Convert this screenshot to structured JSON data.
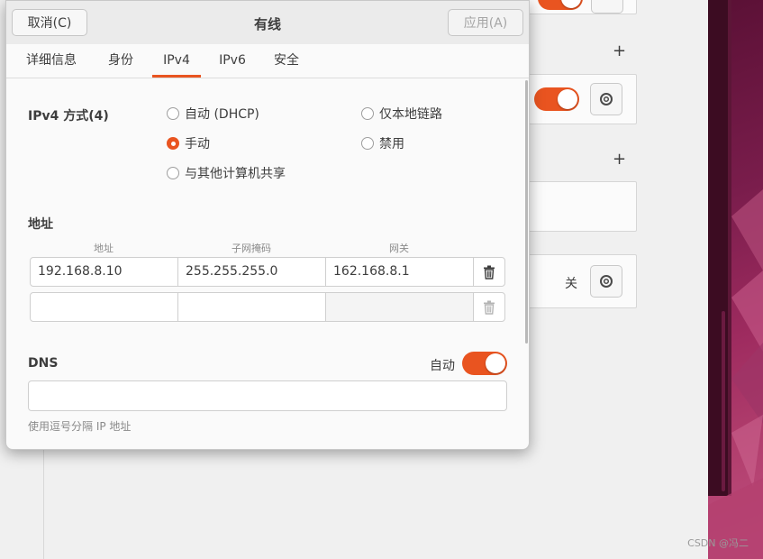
{
  "dialog": {
    "title": "有线",
    "cancel_label": "取消(C)",
    "apply_label": "应用(A)"
  },
  "tabs": [
    {
      "label": "详细信息",
      "active": false
    },
    {
      "label": "身份",
      "active": false
    },
    {
      "label": "IPv4",
      "active": true
    },
    {
      "label": "IPv6",
      "active": false
    },
    {
      "label": "安全",
      "active": false
    }
  ],
  "ipv4_method": {
    "label": "IPv4 方式(4)",
    "options": [
      {
        "label": "自动 (DHCP)",
        "selected": false
      },
      {
        "label": "仅本地链路",
        "selected": false
      },
      {
        "label": "手动",
        "selected": true
      },
      {
        "label": "禁用",
        "selected": false
      },
      {
        "label": "与其他计算机共享",
        "selected": false
      }
    ]
  },
  "addresses": {
    "label": "地址",
    "columns": [
      "地址",
      "子网掩码",
      "网关"
    ],
    "rows": [
      {
        "address": "192.168.8.10",
        "netmask": "255.255.255.0",
        "gateway": "162.168.8.1"
      },
      {
        "address": "",
        "netmask": "",
        "gateway": ""
      }
    ]
  },
  "dns": {
    "label": "DNS",
    "auto_label": "自动",
    "auto_enabled": true,
    "value": "",
    "hint": "使用逗号分隔 IP 地址"
  },
  "background": {
    "off_label": "关",
    "vpn_toggle_on": true
  },
  "watermark": "CSDN @冯二",
  "colors": {
    "accent": "#e95420",
    "header_bg": "#ebebeb",
    "dialog_bg": "#fafafa"
  }
}
